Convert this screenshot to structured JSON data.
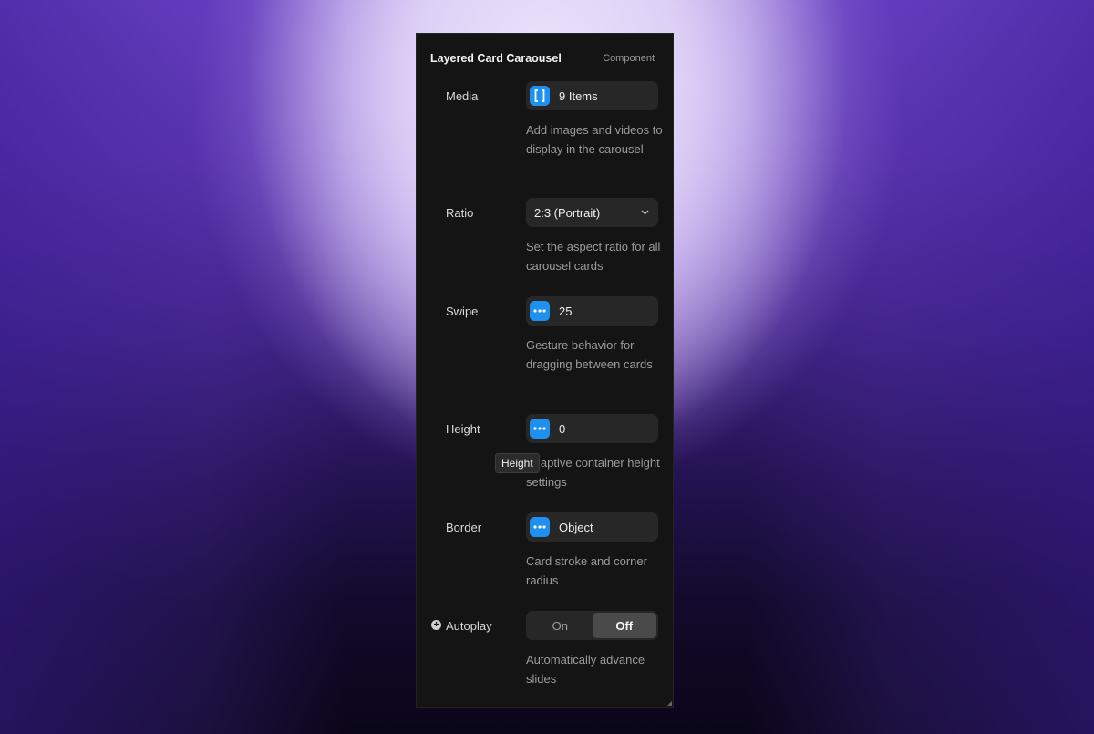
{
  "panel": {
    "title": "Layered Card Caraousel",
    "tag": "Component"
  },
  "rows": {
    "media": {
      "label": "Media",
      "value": "9 Items",
      "icon": "brackets-icon",
      "desc": "Add images and videos to display in the carousel"
    },
    "ratio": {
      "label": "Ratio",
      "value": "2:3 (Portrait)",
      "desc": "Set the aspect ratio for all carousel cards"
    },
    "swipe": {
      "label": "Swipe",
      "value": "25",
      "icon": "dots-icon",
      "desc": "Gesture behavior for dragging between cards"
    },
    "height": {
      "label": "Height",
      "value": "0",
      "icon": "dots-icon",
      "desc": "Adaptive container height settings"
    },
    "border": {
      "label": "Border",
      "value": "Object",
      "icon": "dots-icon",
      "desc": "Card stroke and corner radius"
    },
    "autoplay": {
      "label": "Autoplay",
      "on_label": "On",
      "off_label": "Off",
      "selected": "Off",
      "desc": "Automatically advance slides"
    }
  },
  "tooltip": {
    "text": "Height"
  },
  "colors": {
    "accent": "#1e90f0",
    "panel_bg": "#141414",
    "control_bg": "#272727"
  }
}
